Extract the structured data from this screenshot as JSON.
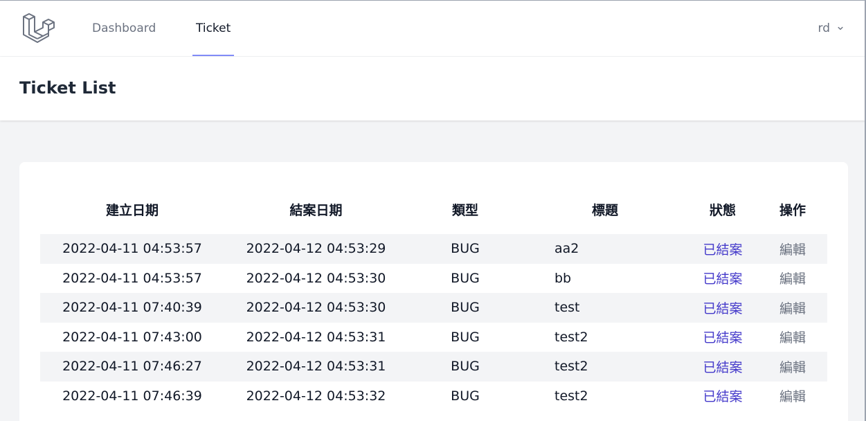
{
  "nav": {
    "links": [
      {
        "label": "Dashboard",
        "active": false
      },
      {
        "label": "Ticket",
        "active": true
      }
    ],
    "user": "rd"
  },
  "header": {
    "title": "Ticket List"
  },
  "table": {
    "headers": [
      "建立日期",
      "結案日期",
      "類型",
      "標題",
      "狀態",
      "操作"
    ],
    "rows": [
      {
        "created": "2022-04-11 04:53:57",
        "closed": "2022-04-12 04:53:29",
        "type": "BUG",
        "title": "aa2",
        "status": "已結案",
        "action": "編輯"
      },
      {
        "created": "2022-04-11 04:53:57",
        "closed": "2022-04-12 04:53:30",
        "type": "BUG",
        "title": "bb",
        "status": "已結案",
        "action": "編輯"
      },
      {
        "created": "2022-04-11 07:40:39",
        "closed": "2022-04-12 04:53:30",
        "type": "BUG",
        "title": "test",
        "status": "已結案",
        "action": "編輯"
      },
      {
        "created": "2022-04-11 07:43:00",
        "closed": "2022-04-12 04:53:31",
        "type": "BUG",
        "title": "test2",
        "status": "已結案",
        "action": "編輯"
      },
      {
        "created": "2022-04-11 07:46:27",
        "closed": "2022-04-12 04:53:31",
        "type": "BUG",
        "title": "test2",
        "status": "已結案",
        "action": "編輯"
      },
      {
        "created": "2022-04-11 07:46:39",
        "closed": "2022-04-12 04:53:32",
        "type": "BUG",
        "title": "test2",
        "status": "已結案",
        "action": "編輯"
      }
    ]
  },
  "colors": {
    "accent": "#818cf8",
    "status_link": "#4338ca",
    "row_stripe": "#f3f4f6",
    "page_bg": "#f3f4f6"
  }
}
